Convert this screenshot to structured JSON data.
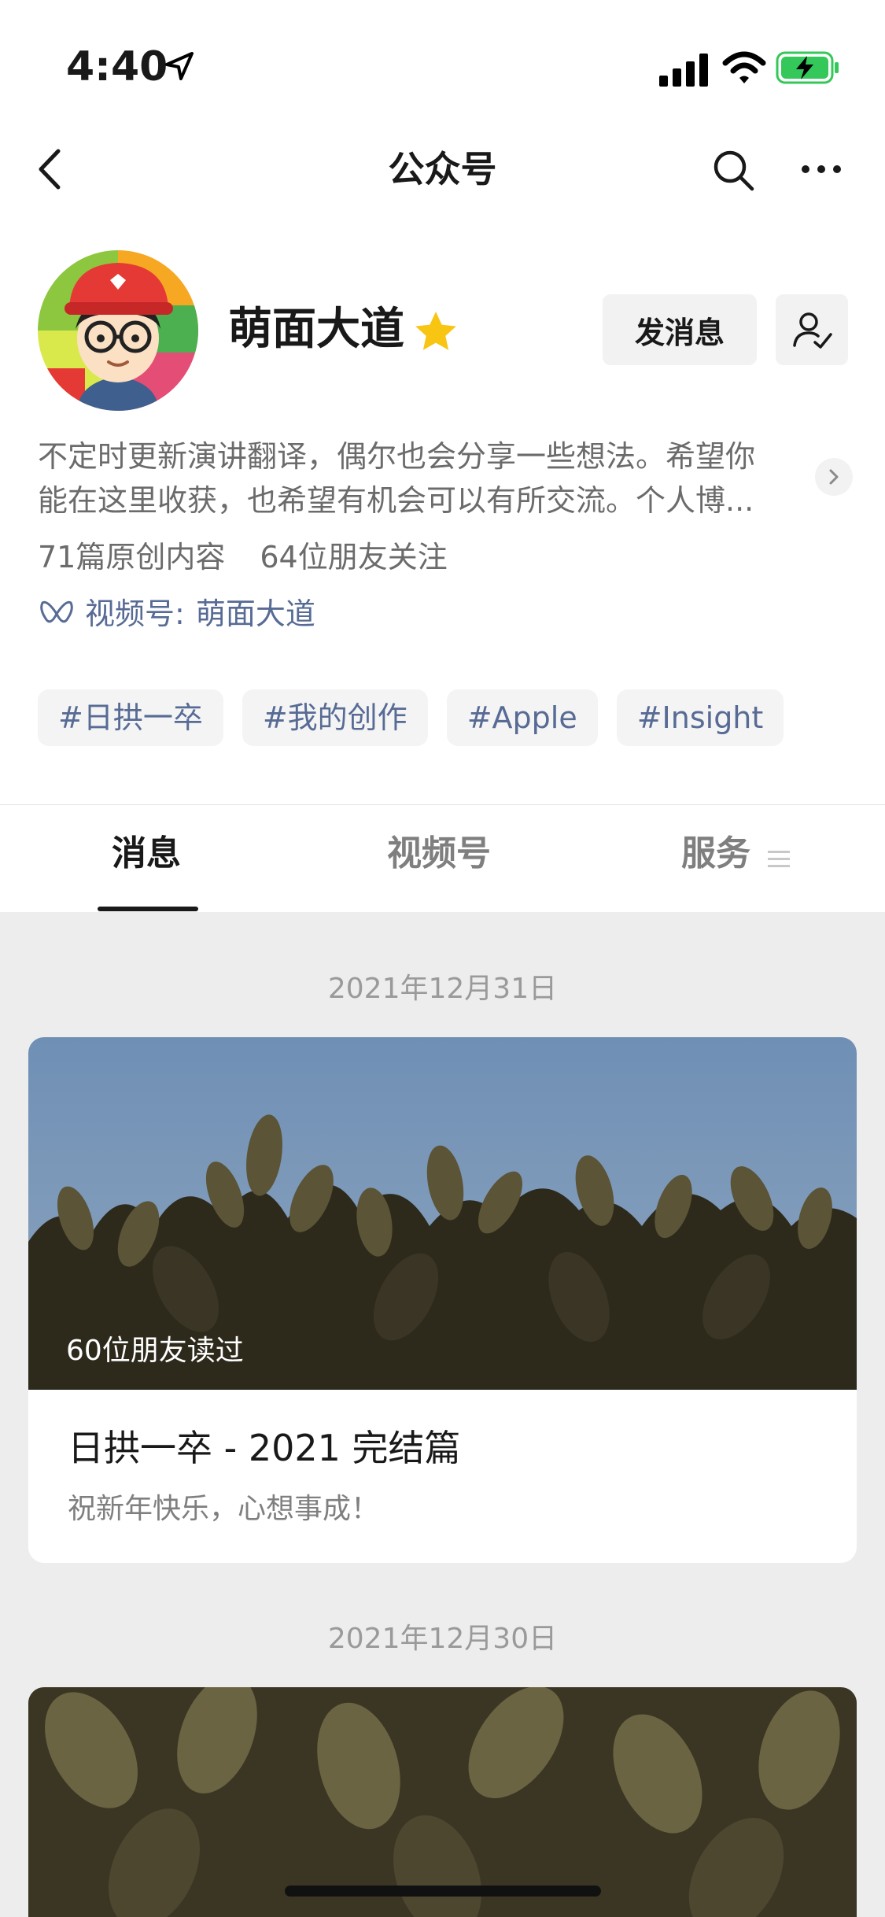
{
  "status_bar": {
    "time": "4:40",
    "battery_color": "#34c759"
  },
  "nav": {
    "title": "公众号"
  },
  "profile": {
    "name": "萌面大道",
    "message_button": "发消息",
    "description_line1": "不定时更新演讲翻译，偶尔也会分享一些想法。希望你",
    "description_line2": "能在这里收获，也希望有机会可以有所交流。个人博...",
    "original_count": "71篇原创内容",
    "friends_following": "64位朋友关注",
    "channel_label": "视频号:",
    "channel_name": "萌面大道",
    "tags": [
      "#日拱一卒",
      "#我的创作",
      "#Apple",
      "#Insight"
    ]
  },
  "tabs": {
    "messages": "消息",
    "channels": "视频号",
    "services": "服务"
  },
  "feed": [
    {
      "date": "2021年12月31日",
      "read_by": "60位朋友读过",
      "title": "日拱一卒 - 2021 完结篇",
      "subtitle": "祝新年快乐，心想事成！"
    },
    {
      "date": "2021年12月30日"
    }
  ],
  "colors": {
    "link": "#576b95",
    "star": "#f9c513",
    "background": "#ededed"
  }
}
